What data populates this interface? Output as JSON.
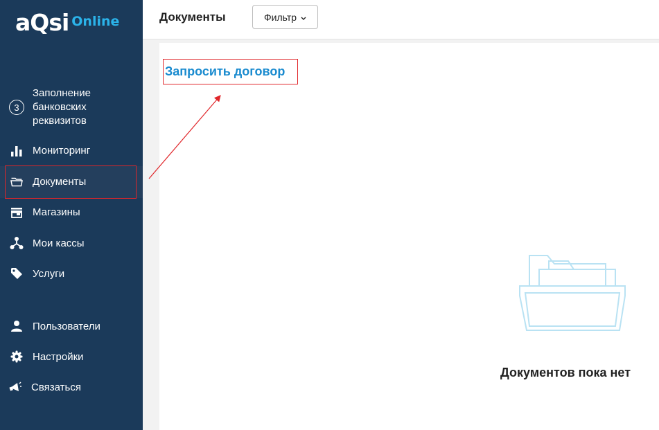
{
  "logo": {
    "main": "aQsi",
    "sub": "Online"
  },
  "sidebar": {
    "items": [
      {
        "label": "Заполнение банковских реквизитов",
        "step": "3"
      },
      {
        "label": "Мониторинг"
      },
      {
        "label": "Документы"
      },
      {
        "label": "Магазины"
      },
      {
        "label": "Мои кассы"
      },
      {
        "label": "Услуги"
      },
      {
        "label": "Пользователи"
      },
      {
        "label": "Настройки"
      },
      {
        "label": "Связаться"
      }
    ]
  },
  "header": {
    "title": "Документы",
    "filter_label": "Фильтр"
  },
  "main": {
    "request_link": "Запросить договор",
    "empty_message": "Документов пока нет"
  },
  "colors": {
    "sidebar_bg": "#1b3a5a",
    "accent": "#2bb3ea",
    "link": "#1a8bcf",
    "annotation": "#e0262a"
  }
}
